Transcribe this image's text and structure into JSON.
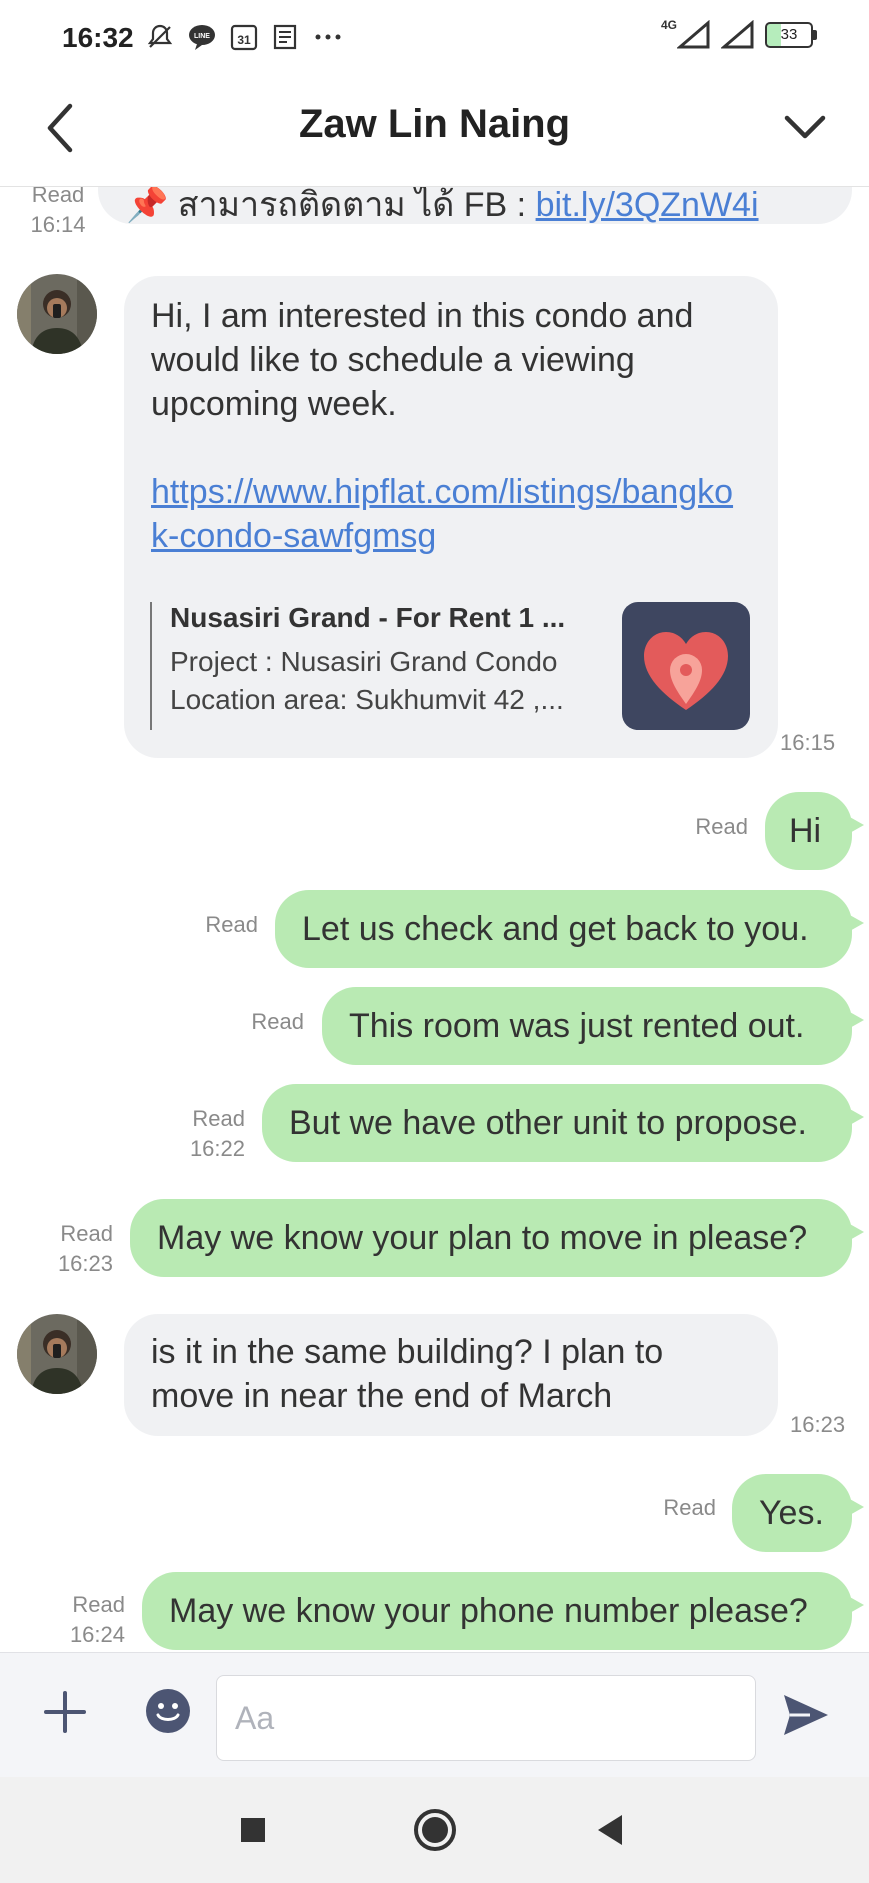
{
  "status_bar": {
    "time": "16:32",
    "calendar_day": "31",
    "network": "4G",
    "battery": "33",
    "icons": [
      "do-not-disturb-icon",
      "line-icon",
      "calendar-icon",
      "news-icon",
      "more-dots-icon",
      "signal-icon",
      "signal-icon",
      "battery-icon"
    ]
  },
  "header": {
    "title": "Zaw Lin Naing",
    "back_icon": "chevron-left-icon",
    "menu_icon": "chevron-down-icon"
  },
  "messages": {
    "m0": {
      "read": "Read",
      "time": "16:14",
      "text": "📌 สามารถติดตาม ได้ FB : ",
      "link": "bit.ly/3QZnW4i"
    },
    "m1": {
      "text": "Hi, I am interested in this condo and would like to schedule a viewing upcoming week.",
      "link": "https://www.hipflat.com/listings/bangkok-condo-sawfgmsg",
      "preview_title": "Nusasiri Grand - For Rent 1 ...",
      "preview_line1": "Project : Nusasiri Grand Condo",
      "preview_line2": "Location area: Sukhumvit 42 ,...",
      "time": "16:15"
    },
    "m2": {
      "read": "Read",
      "text": "Hi"
    },
    "m3": {
      "read": "Read",
      "text": "Let us check and get back to you."
    },
    "m4": {
      "read": "Read",
      "text": "This room was just rented out."
    },
    "m5": {
      "read": "Read",
      "time": "16:22",
      "text": "But we have other unit to propose."
    },
    "m6": {
      "read": "Read",
      "time": "16:23",
      "text": "May we know your plan to move in please?"
    },
    "m7": {
      "text": "is it in the same building? I plan to move in near the end of March",
      "time": "16:23"
    },
    "m8": {
      "read": "Read",
      "text": "Yes."
    },
    "m9": {
      "read": "Read",
      "time": "16:24",
      "text": "May we know your phone number please?"
    }
  },
  "input": {
    "placeholder": "Aa",
    "plus_icon": "plus-icon",
    "emoji_icon": "emoji-icon",
    "send_icon": "send-icon"
  },
  "navbar": {
    "icons": [
      "recents-square-icon",
      "home-circle-icon",
      "back-triangle-icon"
    ]
  },
  "colors": {
    "outgoing_bubble": "#b9eab3",
    "incoming_bubble": "#f0f1f3",
    "link": "#4a7fd4"
  }
}
